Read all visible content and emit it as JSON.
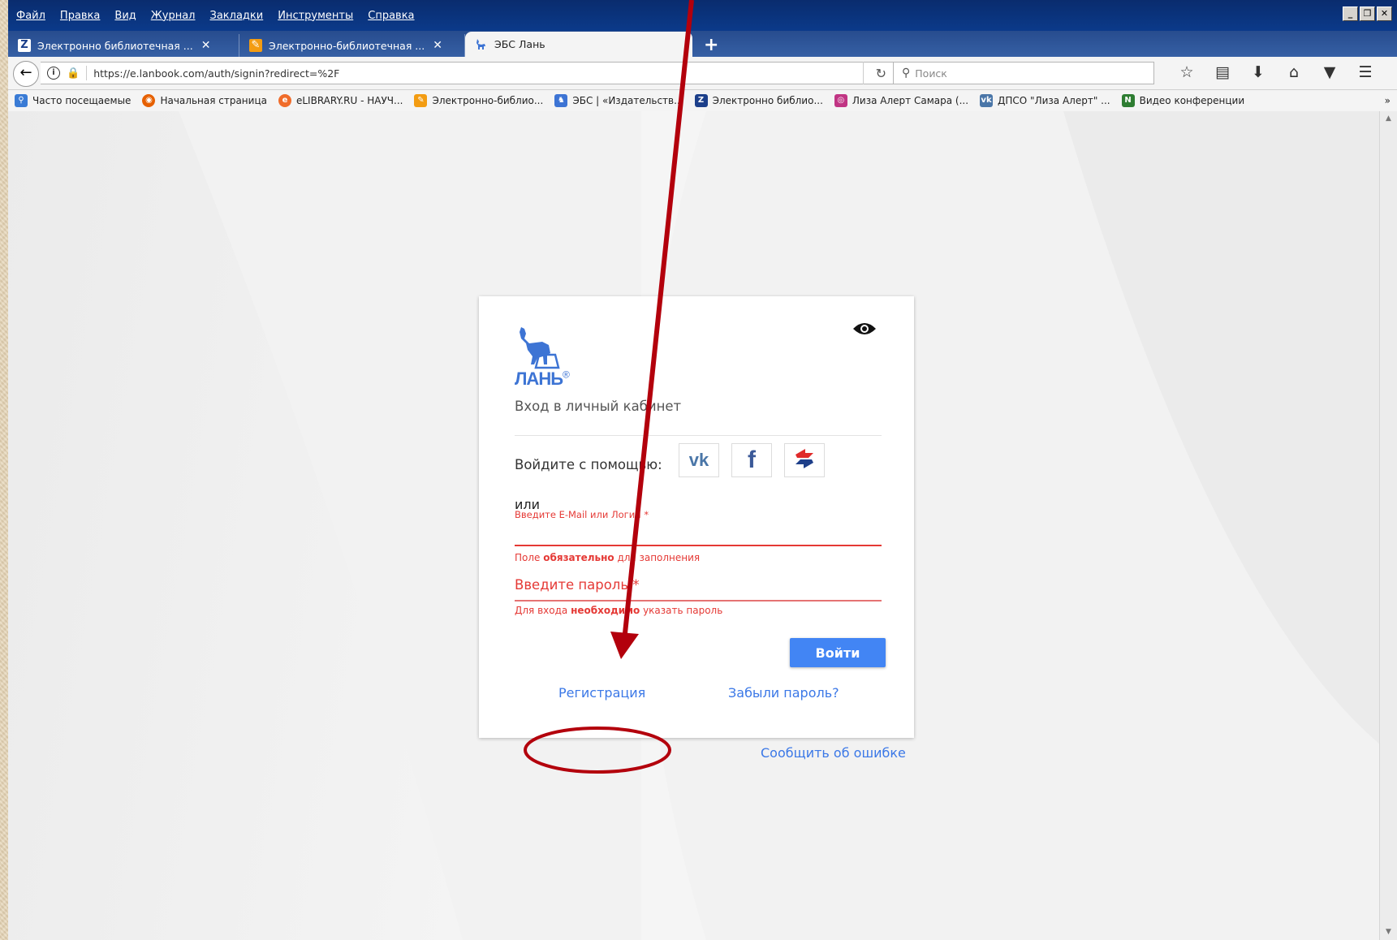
{
  "menu": [
    "Файл",
    "Правка",
    "Вид",
    "Журнал",
    "Закладки",
    "Инструменты",
    "Справка"
  ],
  "window_controls": [
    "_",
    "❐",
    "✕"
  ],
  "tabs": [
    {
      "label": "Электронно библиотечная ...",
      "icon": "Z",
      "close": "✕"
    },
    {
      "label": "Электронно-библиотечная ...",
      "icon": "✎",
      "close": "✕"
    },
    {
      "label": "ЭБС Лань",
      "icon": "deer",
      "close": ""
    }
  ],
  "new_tab": "+",
  "url": "https://e.lanbook.com/auth/signin?redirect=%2F",
  "search_placeholder": "Поиск",
  "bookmarks": [
    {
      "label": "Часто посещаемые",
      "icon_color": "#3a7bd5",
      "icon": "⚲"
    },
    {
      "label": "Начальная страница",
      "icon_color": "#e66000",
      "icon": "◉"
    },
    {
      "label": "eLIBRARY.RU - НАУЧ...",
      "icon_color": "#f06c2a",
      "icon": "e"
    },
    {
      "label": "Электронно-библио...",
      "icon_color": "#f39c12",
      "icon": "✎"
    },
    {
      "label": "ЭБС | «Издательств...",
      "icon_color": "#3d74d4",
      "icon": "♞"
    },
    {
      "label": "Электронно библио...",
      "icon_color": "#1c3f8a",
      "icon": "Z"
    },
    {
      "label": "Лиза Алерт Самара (...",
      "icon_color": "#c13584",
      "icon": "◎"
    },
    {
      "label": "ДПСО \"Лиза Алерт\" ...",
      "icon_color": "#4a76a8",
      "icon": "vk"
    },
    {
      "label": "Видео конференции",
      "icon_color": "#2e7d32",
      "icon": "N"
    }
  ],
  "bookmarks_more": "»",
  "card": {
    "logo_text": "ЛАНЬ",
    "logo_reg": "®",
    "title": "Вход в личный кабинет",
    "social_label": "Войдите с помощью:",
    "or": "или",
    "email_label": "Введите E-Mail или Логин *",
    "email_error_pre": "Поле ",
    "email_error_bold": "обязательно",
    "email_error_post": " для заполнения",
    "password_placeholder": "Введите пароль *",
    "password_error_pre": "Для входа ",
    "password_error_bold": "необходимо",
    "password_error_post": " указать пароль",
    "login_button": "Войти",
    "register_link": "Регистрация",
    "forgot_link": "Забыли пароль?"
  },
  "report_link": "Сообщить об ошибке",
  "colors": {
    "accent": "#4285f4",
    "link": "#3b78e7",
    "error": "#e53935",
    "annotation": "#b3000c"
  }
}
